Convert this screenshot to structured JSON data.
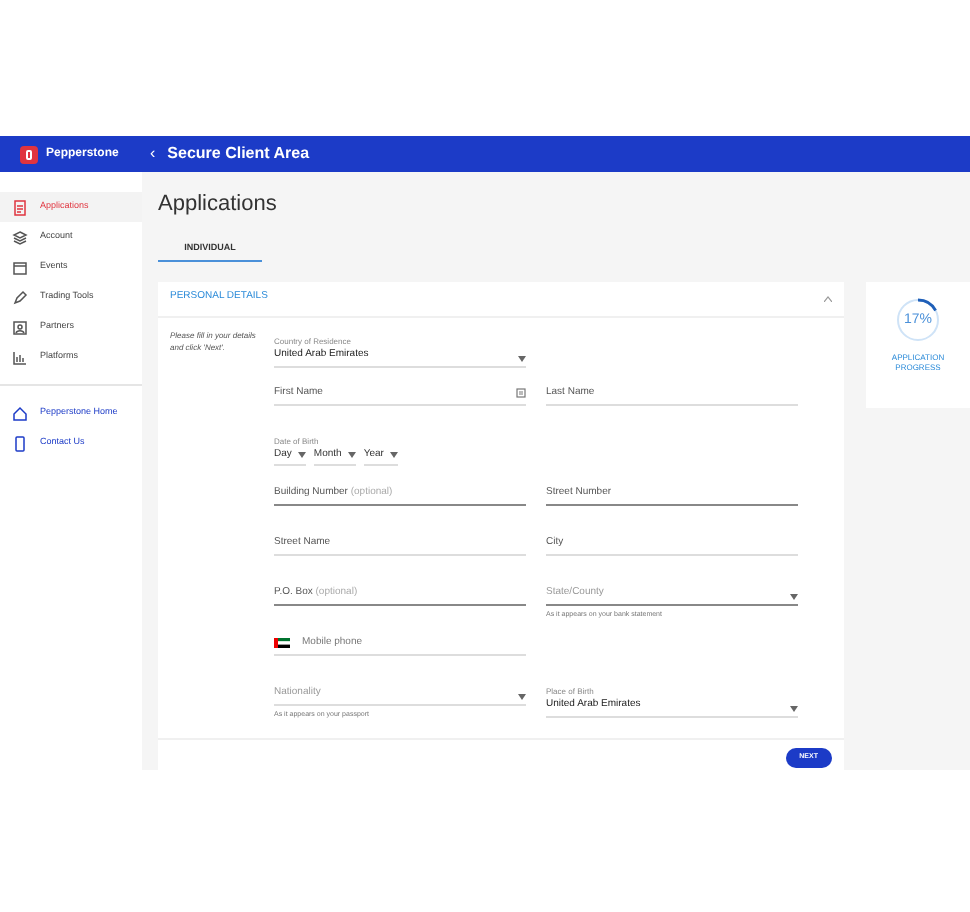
{
  "header": {
    "brand": "Pepperstone",
    "back_icon": "‹",
    "title": "Secure Client Area"
  },
  "sidebar": {
    "items": [
      {
        "label": "Applications",
        "selected": true
      },
      {
        "label": "Account",
        "selected": false
      },
      {
        "label": "Events",
        "selected": false
      },
      {
        "label": "Trading Tools",
        "selected": false
      },
      {
        "label": "Partners",
        "selected": false
      },
      {
        "label": "Platforms",
        "selected": false
      }
    ],
    "links": [
      {
        "label": "Pepperstone Home"
      },
      {
        "label": "Contact Us"
      }
    ]
  },
  "page_title": "Applications",
  "tabs": [
    {
      "label": "INDIVIDUAL",
      "selected": true
    }
  ],
  "section": {
    "title": "PERSONAL DETAILS",
    "expanded": true,
    "intro": "Please fill in your details and click 'Next'.",
    "rows": [
      [
        {
          "kind": "select",
          "label": "Country of Residence",
          "value": "United Arab Emirates"
        },
        null
      ],
      [
        {
          "kind": "iconfield",
          "placeholder": "First Name"
        },
        {
          "kind": "text",
          "placeholder": "Last Name"
        }
      ],
      [
        {
          "kind": "date",
          "label": "Date of Birth",
          "parts": [
            "Day",
            "Month",
            "Year"
          ]
        },
        null
      ],
      [
        {
          "kind": "text",
          "placeholder": "Building Number",
          "note": "(optional)",
          "active": true
        },
        {
          "kind": "text",
          "placeholder": "Street Number",
          "active": true
        }
      ],
      [
        {
          "kind": "text",
          "placeholder": "Street Name"
        },
        {
          "kind": "text",
          "placeholder": "City"
        }
      ],
      [
        {
          "kind": "text",
          "placeholder": "P.O. Box",
          "note": "(optional)",
          "active": true
        },
        {
          "kind": "select",
          "placeholder": "State/County",
          "helper": "As it appears on your bank statement",
          "active": true
        }
      ],
      [
        {
          "kind": "phone",
          "placeholder": "Mobile phone"
        },
        null
      ],
      [
        {
          "kind": "select",
          "placeholder": "Nationality",
          "helper": "As it appears on your passport"
        },
        {
          "kind": "select",
          "label": "Place of Birth",
          "value": "United Arab Emirates"
        }
      ]
    ],
    "next_button": "NEXT"
  },
  "progress": {
    "value": "17%",
    "level": 0.17,
    "label": "APPLICATION PROGRESS"
  }
}
